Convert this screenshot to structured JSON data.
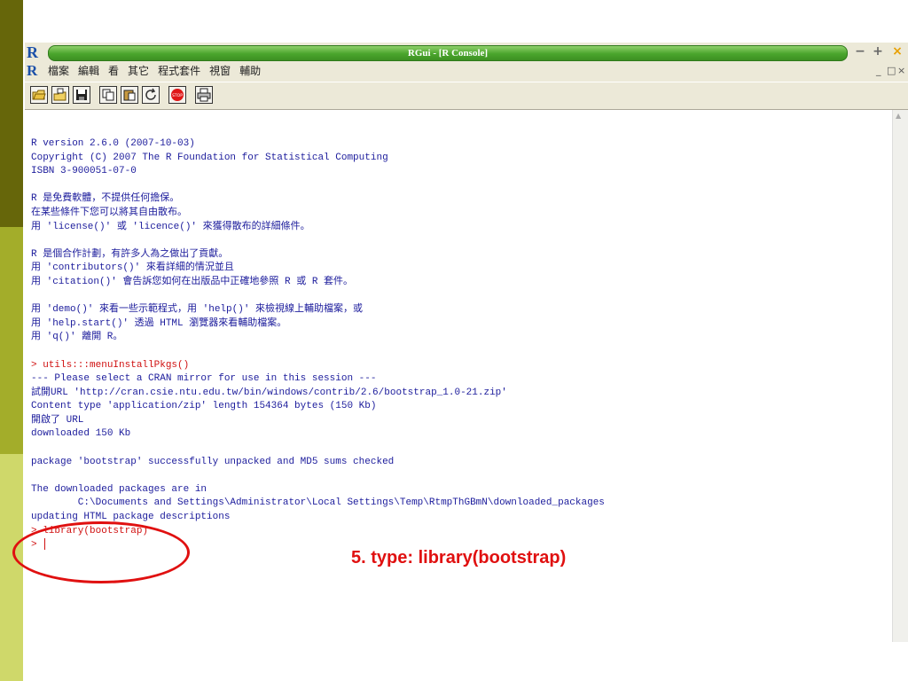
{
  "window": {
    "title": "RGui - [R Console]",
    "logo": "R"
  },
  "menubar": {
    "logo": "R",
    "items": [
      "檔案",
      "編輯",
      "看",
      "其它",
      "程式套件",
      "視窗",
      "輔助"
    ],
    "mdi_controls": [
      "_",
      "□",
      "×"
    ]
  },
  "toolbar": {
    "tools": [
      "open-script-icon",
      "load-workspace-icon",
      "save-icon",
      "copy-icon",
      "paste-icon",
      "refresh-icon",
      "stop-icon",
      "print-icon"
    ]
  },
  "console": {
    "lines": [
      {
        "text": "R version 2.6.0 (2007-10-03)",
        "color": "blue"
      },
      {
        "text": "Copyright (C) 2007 The R Foundation for Statistical Computing",
        "color": "blue"
      },
      {
        "text": "ISBN 3-900051-07-0",
        "color": "blue"
      },
      {
        "text": "",
        "color": "blue"
      },
      {
        "text": "R 是免費軟體，不提供任何擔保。",
        "color": "blue"
      },
      {
        "text": "在某些條件下您可以將其自由散布。",
        "color": "blue"
      },
      {
        "text": "用 'license()' 或 'licence()' 來獲得散布的詳細條件。",
        "color": "blue"
      },
      {
        "text": "",
        "color": "blue"
      },
      {
        "text": "R 是個合作計劃，有許多人為之做出了貢獻。",
        "color": "blue"
      },
      {
        "text": "用 'contributors()' 來看詳細的情況並且",
        "color": "blue"
      },
      {
        "text": "用 'citation()' 會告訴您如何在出版品中正確地參照 R 或 R 套件。",
        "color": "blue"
      },
      {
        "text": "",
        "color": "blue"
      },
      {
        "text": "用 'demo()' 來看一些示範程式，用 'help()' 來檢視線上輔助檔案，或",
        "color": "blue"
      },
      {
        "text": "用 'help.start()' 透過 HTML 瀏覽器來看輔助檔案。",
        "color": "blue"
      },
      {
        "text": "用 'q()' 離開 R。",
        "color": "blue"
      },
      {
        "text": "",
        "color": "blue"
      },
      {
        "text": "> utils:::menuInstallPkgs()",
        "color": "red"
      },
      {
        "text": "--- Please select a CRAN mirror for use in this session ---",
        "color": "blue"
      },
      {
        "text": "試開URL 'http://cran.csie.ntu.edu.tw/bin/windows/contrib/2.6/bootstrap_1.0-21.zip'",
        "color": "blue"
      },
      {
        "text": "Content type 'application/zip' length 154364 bytes (150 Kb)",
        "color": "blue"
      },
      {
        "text": "開啟了 URL",
        "color": "blue"
      },
      {
        "text": "downloaded 150 Kb",
        "color": "blue"
      },
      {
        "text": "",
        "color": "blue"
      },
      {
        "text": "package 'bootstrap' successfully unpacked and MD5 sums checked",
        "color": "blue"
      },
      {
        "text": "",
        "color": "blue"
      },
      {
        "text": "The downloaded packages are in",
        "color": "blue"
      },
      {
        "text": "        C:\\Documents and Settings\\Administrator\\Local Settings\\Temp\\RtmpThGBmN\\downloaded_packages",
        "color": "blue"
      },
      {
        "text": "updating HTML package descriptions",
        "color": "blue"
      },
      {
        "text": "> library(bootstrap)",
        "color": "red"
      },
      {
        "text": "> ",
        "color": "red",
        "cursor": true
      }
    ]
  },
  "annotation": {
    "text": "5. type: library(bootstrap)"
  },
  "colors": {
    "console_blue": "#1c1c9c",
    "console_red": "#d01010",
    "annotation_red": "#e01010",
    "titlebar_green": "#4aa52c"
  }
}
